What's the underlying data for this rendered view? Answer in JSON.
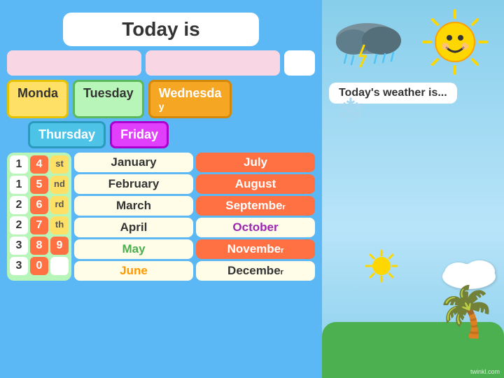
{
  "header": {
    "today_is_label": "Today is"
  },
  "days": {
    "monday": "Monda",
    "tuesday": "Tuesday",
    "wednesday": "Wednesda\ny",
    "thursday": "Thursday",
    "friday": "Friday"
  },
  "date_numbers": [
    {
      "val": "1"
    },
    {
      "val": "4"
    },
    {
      "suffix": "st"
    },
    {
      "val": "1"
    },
    {
      "val": "5"
    },
    {
      "suffix": "nd"
    },
    {
      "val": "2"
    },
    {
      "val": "6"
    },
    {
      "suffix": "rd"
    },
    {
      "val": "2"
    },
    {
      "val": "7"
    },
    {
      "suffix": "th"
    },
    {
      "val": "3"
    },
    {
      "val": "8"
    },
    {
      "val": "9"
    },
    {
      "val": "3"
    },
    {
      "val": "0"
    },
    {
      "val": ""
    }
  ],
  "months_left": [
    "January",
    "February",
    "March",
    "April",
    "May",
    "June"
  ],
  "months_right": [
    "July",
    "August",
    "September",
    "October",
    "November",
    "December"
  ],
  "weather": {
    "label": "Today's weather is..."
  },
  "twinkl": "twinkl.com"
}
